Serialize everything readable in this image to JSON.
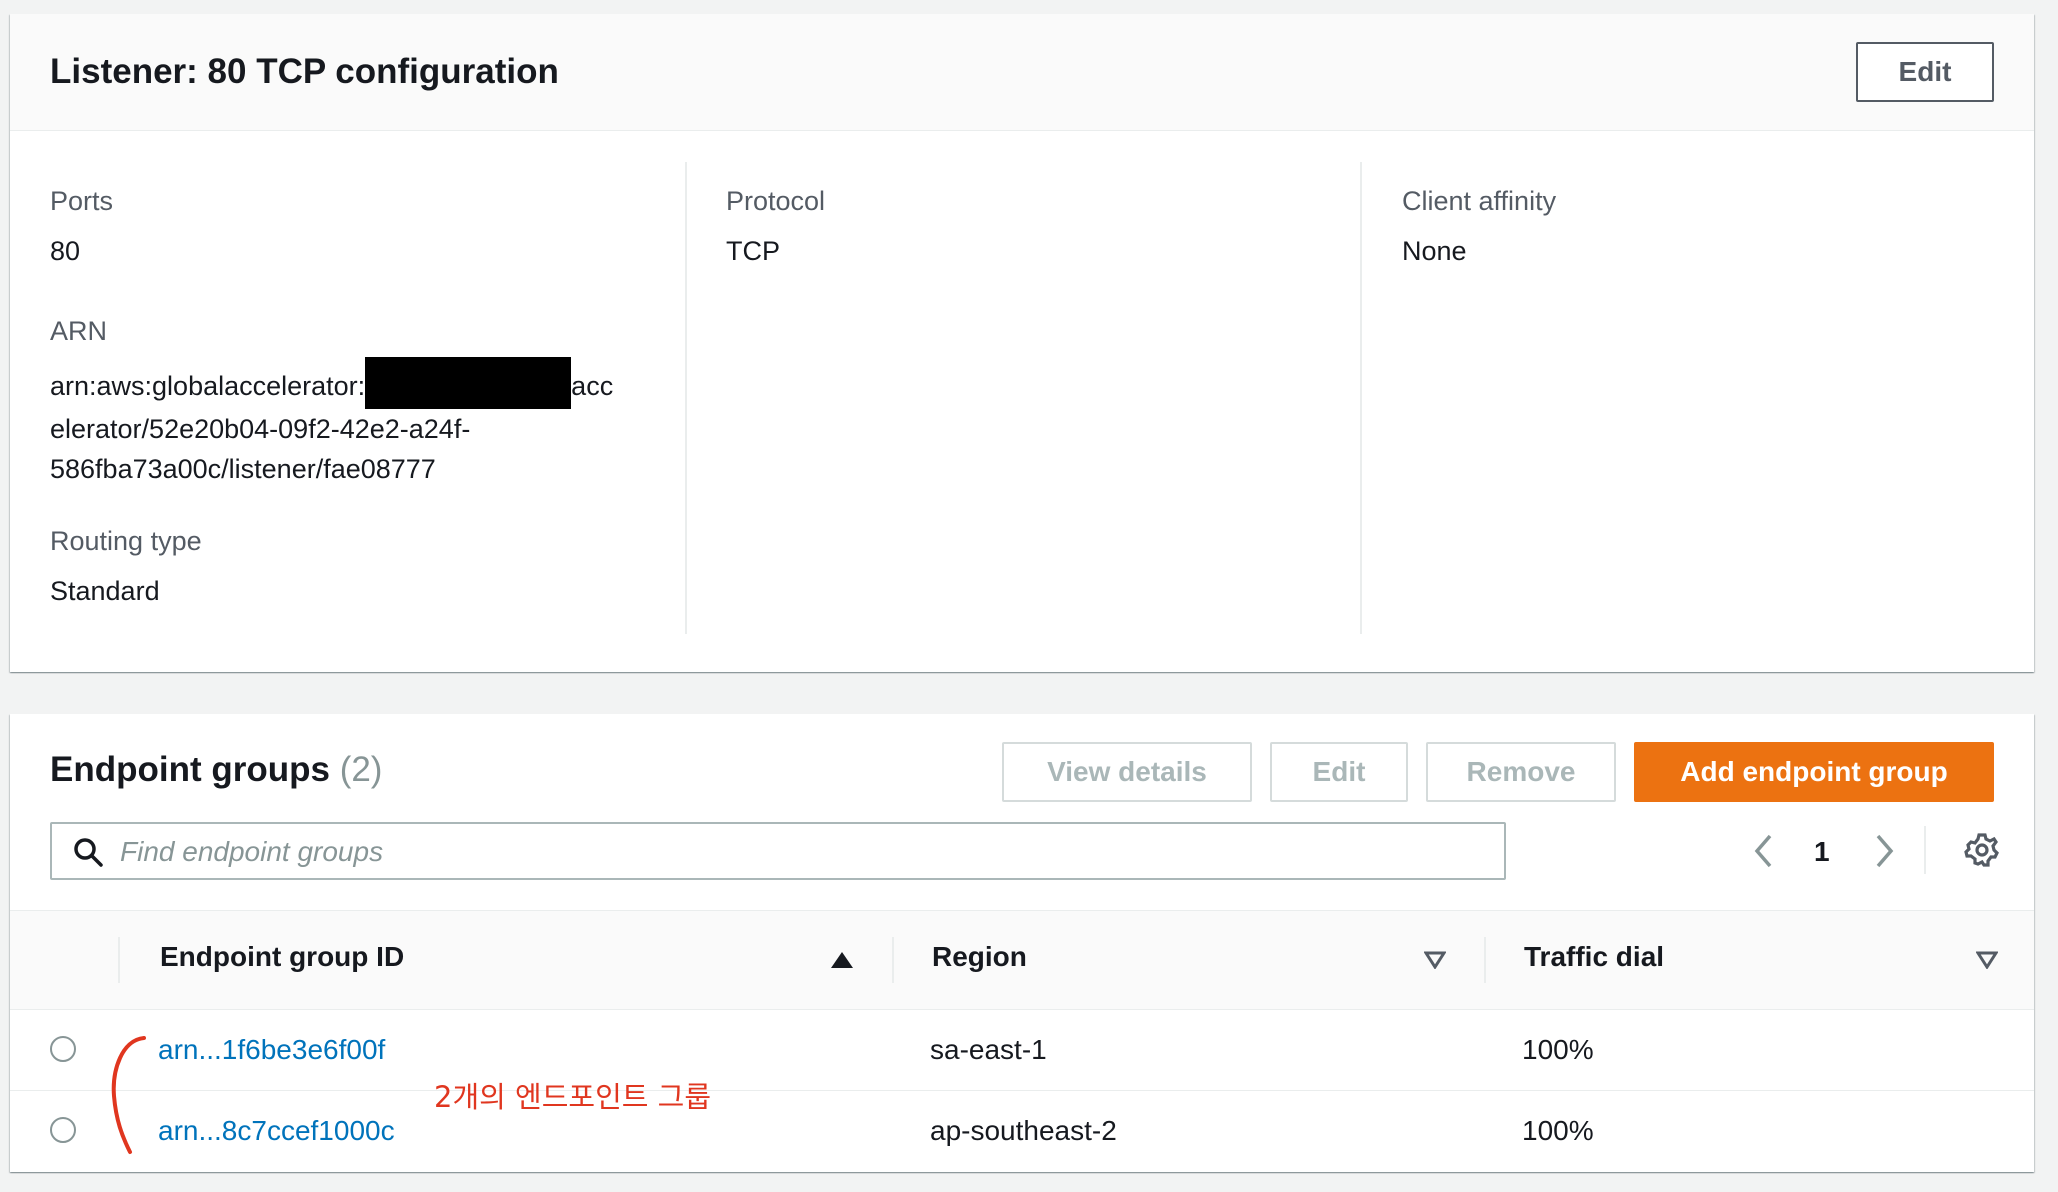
{
  "listener": {
    "title": "Listener: 80 TCP configuration",
    "edit_label": "Edit",
    "ports_label": "Ports",
    "ports_value": "80",
    "arn_label": "ARN",
    "arn_prefix": "arn:aws:globalaccelerator:",
    "arn_after_redaction": "acc",
    "arn_line2": "elerator/52e20b04-09f2-42e2-a24f-",
    "arn_line3": "586fba73a00c/listener/fae08777",
    "routing_label": "Routing type",
    "routing_value": "Standard",
    "protocol_label": "Protocol",
    "protocol_value": "TCP",
    "affinity_label": "Client affinity",
    "affinity_value": "None"
  },
  "endpoint_groups": {
    "title": "Endpoint groups",
    "count": "(2)",
    "buttons": {
      "view_details": "View details",
      "edit": "Edit",
      "remove": "Remove",
      "add": "Add endpoint group"
    },
    "search": {
      "placeholder": "Find endpoint groups"
    },
    "pagination": {
      "current_page": "1"
    },
    "columns": [
      "Endpoint group ID",
      "Region",
      "Traffic dial"
    ],
    "rows": [
      {
        "id": "arn...1f6be3e6f00f",
        "region": "sa-east-1",
        "traffic_dial": "100%"
      },
      {
        "id": "arn...8c7ccef1000c",
        "region": "ap-southeast-2",
        "traffic_dial": "100%"
      }
    ]
  },
  "annotation": {
    "text": "2개의 엔드포인트 그룹",
    "color": "#e0361f"
  },
  "colors": {
    "primary": "#ec7211",
    "link": "#0073bb",
    "text": "#16191f",
    "muted": "#545b64"
  }
}
